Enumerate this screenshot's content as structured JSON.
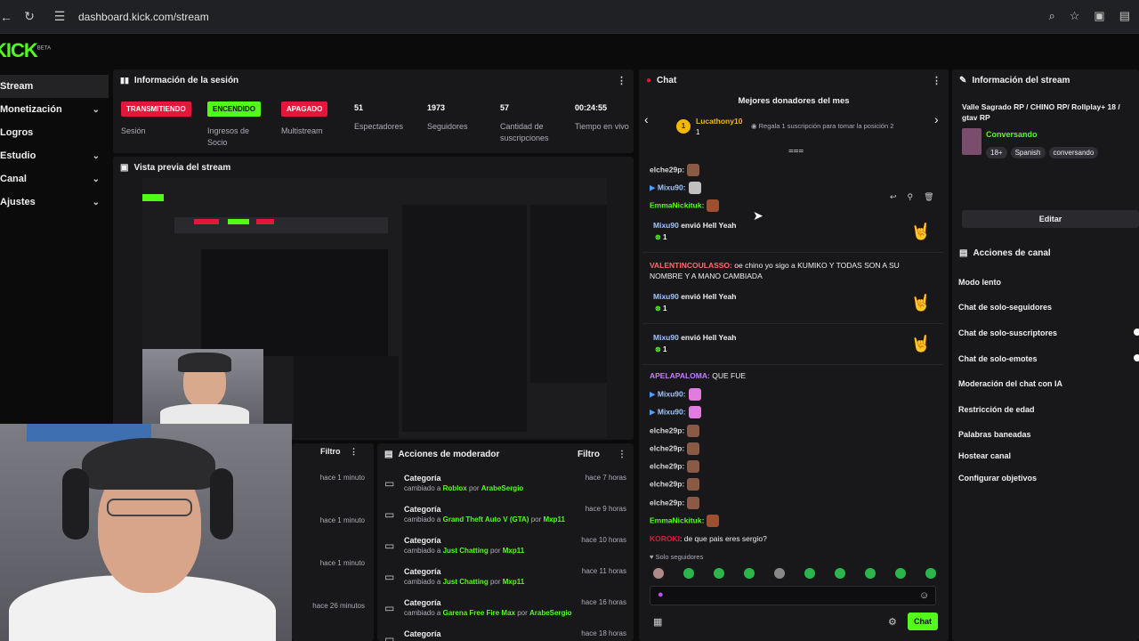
{
  "browser": {
    "url": "dashboard.kick.com/stream"
  },
  "brand": {
    "logo": "KICK",
    "beta": "BETA",
    "accent": "#53fc18"
  },
  "sidebar": {
    "items": [
      {
        "label": "Stream",
        "has_chevron": false
      },
      {
        "label": "Monetización",
        "has_chevron": true
      },
      {
        "label": "Logros",
        "has_chevron": false
      },
      {
        "label": "Estudio",
        "has_chevron": true
      },
      {
        "label": "Canal",
        "has_chevron": true
      },
      {
        "label": "Ajustes",
        "has_chevron": true
      }
    ]
  },
  "session": {
    "title": "Información de la sesión",
    "stats": [
      {
        "value": "TRANSMITIENDO",
        "label": "Sesión",
        "kind": "badge-red"
      },
      {
        "value": "ENCENDIDO",
        "label": "Ingresos de Socio",
        "kind": "badge-green"
      },
      {
        "value": "APAGADO",
        "label": "Multistream",
        "kind": "badge-red"
      },
      {
        "value": "51",
        "label": "Espectadores",
        "kind": "number"
      },
      {
        "value": "1973",
        "label": "Seguidores",
        "kind": "number"
      },
      {
        "value": "57",
        "label": "Cantidad de suscripciones",
        "kind": "number"
      },
      {
        "value": "00:24:55",
        "label": "Tiempo en vivo",
        "kind": "number"
      }
    ]
  },
  "preview": {
    "title": "Vista previa del stream"
  },
  "log_left": {
    "filter": "Filtro",
    "times": [
      "hace 1 minuto",
      "hace 1 minuto",
      "hace 1 minuto",
      "hace 26 minutos"
    ]
  },
  "mod_actions": {
    "title": "Acciones de moderador",
    "filter": "Filtro",
    "items": [
      {
        "title": "Categoría",
        "prefix": "cambiado a",
        "game": "Roblox",
        "by": "por",
        "user": "ArabeSergio",
        "time": "hace 7 horas"
      },
      {
        "title": "Categoría",
        "prefix": "cambiado a",
        "game": "Grand Theft Auto V (GTA)",
        "by": "por",
        "user": "Mxp11",
        "time": "hace 9 horas"
      },
      {
        "title": "Categoría",
        "prefix": "cambiado a",
        "game": "Just Chatting",
        "by": "por",
        "user": "Mxp11",
        "time": "hace 10 horas"
      },
      {
        "title": "Categoría",
        "prefix": "cambiado a",
        "game": "Just Chatting",
        "by": "por",
        "user": "Mxp11",
        "time": "hace 11 horas"
      },
      {
        "title": "Categoría",
        "prefix": "cambiado a",
        "game": "Garena Free Fire Max",
        "by": "por",
        "user": "ArabeSergio",
        "time": "hace 16 horas"
      },
      {
        "title": "Categoría",
        "prefix": "",
        "game": "",
        "by": "",
        "user": "",
        "time": "hace 18 horas"
      }
    ]
  },
  "chat": {
    "title": "Chat",
    "donors_title": "Mejores donadores del mes",
    "top_donor": {
      "name": "Lucathony10",
      "rank": "1",
      "count": "1"
    },
    "cta": "Regala 1 suscripción para tomar la posición 2",
    "messages": [
      {
        "user": "elche29p:",
        "text": "",
        "color": "#d9d9d9",
        "emote": "#8a5a44"
      },
      {
        "user": "Mixu90:",
        "text": "",
        "color": "#a0c4ff",
        "emote": "#c0c0c0"
      },
      {
        "user": "EmmaNickituk:",
        "text": "",
        "color": "#53fc18",
        "emote": "#a0502e"
      }
    ],
    "cards": [
      {
        "user": "Mixu90",
        "text": "envió Hell Yeah",
        "count": "1"
      },
      {
        "user": "Mixu90",
        "text": "envió Hell Yeah",
        "count": "1"
      },
      {
        "user": "Mixu90",
        "text": "envió Hell Yeah",
        "count": "1"
      }
    ],
    "valentin": {
      "user": "VALENTINCOULASSO:",
      "text": "oe chino yo sigo a KUMIKO Y TODAS SON A SU NOMBRE Y A MANO CAMBIADA"
    },
    "apela": {
      "user": "APELAPALOMA:",
      "text": "QUE FUE"
    },
    "tail": [
      {
        "user": "Mixu90:",
        "color": "#a0c4ff",
        "emote": "#e07be0"
      },
      {
        "user": "Mixu90:",
        "color": "#a0c4ff",
        "emote": "#e07be0"
      },
      {
        "user": "elche29p:",
        "color": "#d9d9d9",
        "emote": "#8a5a44"
      },
      {
        "user": "elche29p:",
        "color": "#d9d9d9",
        "emote": "#8a5a44"
      },
      {
        "user": "elche29p:",
        "color": "#d9d9d9",
        "emote": "#8a5a44"
      },
      {
        "user": "elche29p:",
        "color": "#d9d9d9",
        "emote": "#8a5a44"
      },
      {
        "user": "elche29p:",
        "color": "#d9d9d9",
        "emote": "#8a5a44"
      },
      {
        "user": "EmmaNickituk:",
        "color": "#53fc18",
        "emote": "#a0502e"
      }
    ],
    "koroki": {
      "user": "KOROKI",
      "text": ": de que pais eres sergio?"
    },
    "mode": "Solo seguidores",
    "send": "Chat"
  },
  "stream_info": {
    "title": "Información del stream",
    "stream_title": "Valle Sagrado RP / CHINO RP/ Rollplay+ 18 / gtav RP",
    "category": "Conversando",
    "tags": [
      "18+",
      "Spanish",
      "conversando"
    ],
    "edit": "Editar"
  },
  "channel_actions": {
    "title": "Acciones de canal",
    "items": [
      "Modo lento",
      "Chat de solo-seguidores",
      "Chat de solo-suscriptores",
      "Chat de solo-emotes",
      "Moderación del chat con IA",
      "Restricción de edad",
      "Palabras baneadas",
      "Hostear canal",
      "Configurar objetivos"
    ]
  }
}
